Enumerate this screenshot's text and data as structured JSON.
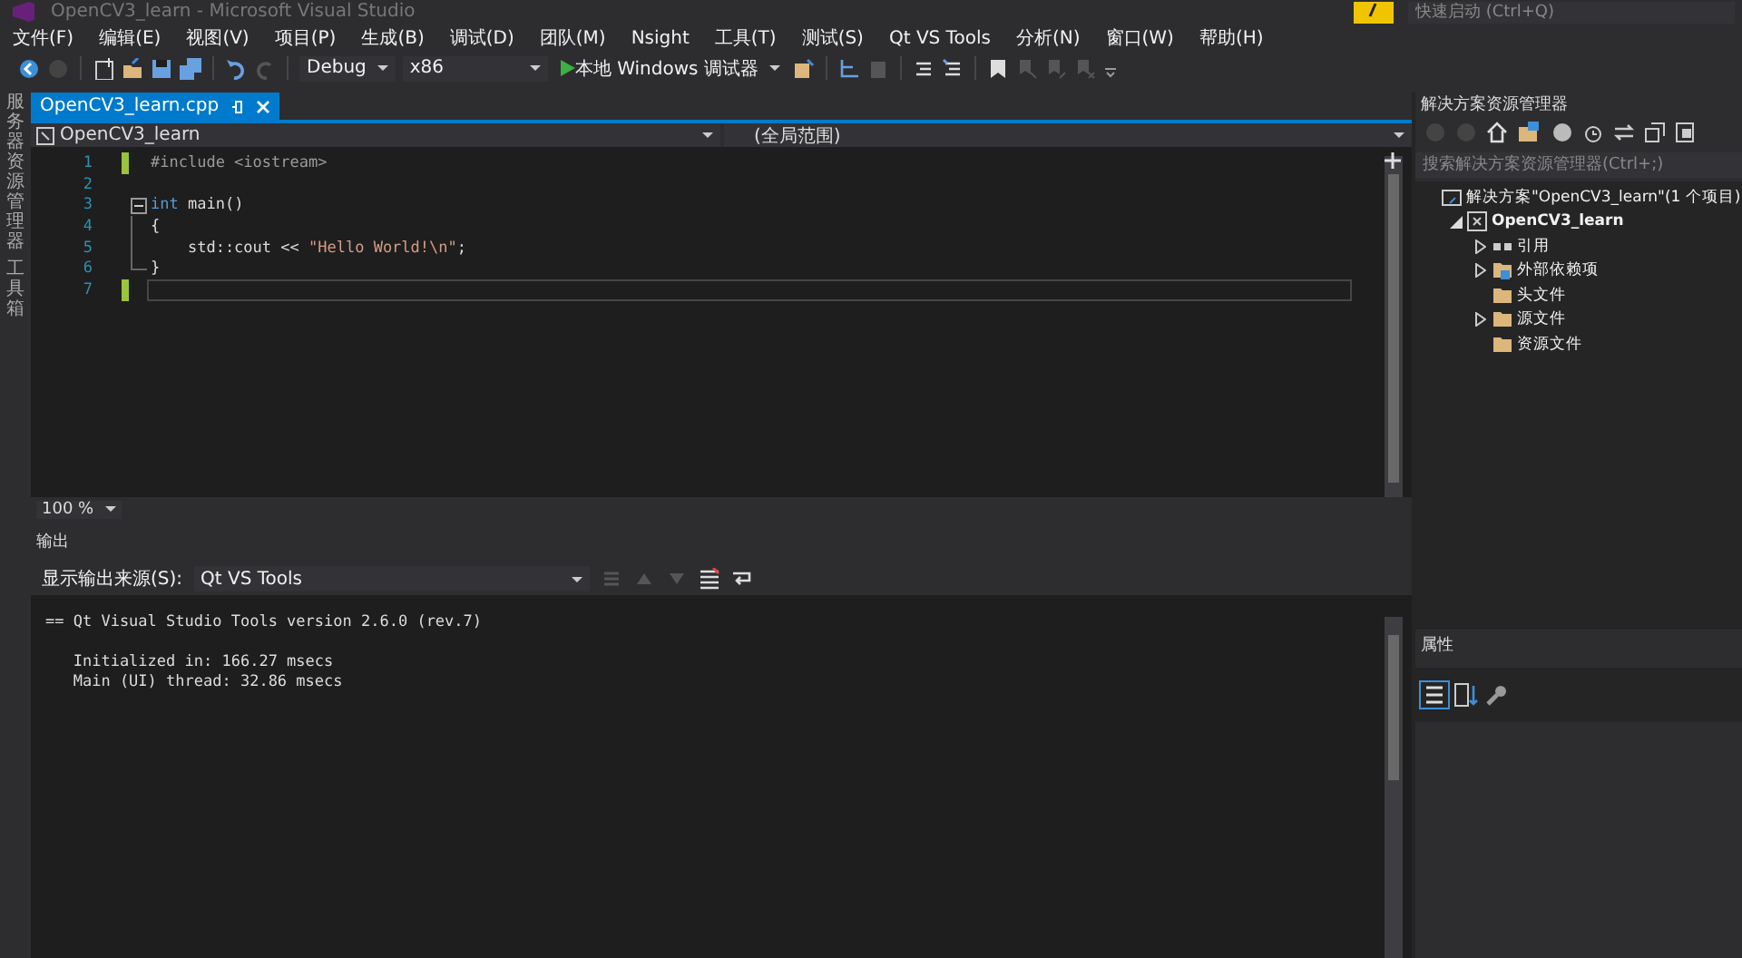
{
  "window": {
    "title": "OpenCV3_learn - Microsoft Visual Studio"
  },
  "quick_launch": {
    "placeholder": "快速启动 (Ctrl+Q)"
  },
  "menu": [
    "文件(F)",
    "编辑(E)",
    "视图(V)",
    "项目(P)",
    "生成(B)",
    "调试(D)",
    "团队(M)",
    "Nsight",
    "工具(T)",
    "测试(S)",
    "Qt VS Tools",
    "分析(N)",
    "窗口(W)",
    "帮助(H)"
  ],
  "toolbar": {
    "configuration": "Debug",
    "platform": "x86",
    "run": "本地 Windows 调试器"
  },
  "left_tabs": [
    "服务器资源管理器",
    "工具箱"
  ],
  "editor": {
    "tabs": [
      {
        "label": "OpenCV3_learn.cpp",
        "selected": true
      }
    ],
    "nav": {
      "project": "OpenCV3_learn",
      "scope": "(全局范围)"
    },
    "lines": [
      {
        "number": "1",
        "changed": true,
        "current": false,
        "kind": "plain",
        "tokens": [
          {
            "kind": "preproc",
            "text": "#include <iostream>"
          }
        ]
      },
      {
        "number": "2",
        "changed": false,
        "current": false,
        "kind": "plain"
      },
      {
        "number": "3",
        "changed": false,
        "current": false,
        "kind": "block_start",
        "tokens": [
          {
            "kind": "keyword",
            "text": "int"
          },
          {
            "kind": "plain",
            "text": " main()"
          }
        ]
      },
      {
        "number": "4",
        "changed": false,
        "current": false,
        "kind": "block_body",
        "tokens": [
          {
            "kind": "plain",
            "text": "{"
          }
        ]
      },
      {
        "number": "5",
        "changed": false,
        "current": false,
        "kind": "block_body",
        "tokens": [
          {
            "kind": "plain",
            "text": "    std::cout << "
          },
          {
            "kind": "string",
            "text": "\"Hello World!\\n\""
          },
          {
            "kind": "plain",
            "text": ";"
          }
        ]
      },
      {
        "number": "6",
        "changed": false,
        "current": false,
        "kind": "block_end",
        "tokens": [
          {
            "kind": "plain",
            "text": "}"
          }
        ]
      },
      {
        "number": "7",
        "changed": true,
        "current": true,
        "kind": "plain"
      }
    ],
    "zoom": "100 %"
  },
  "output": {
    "title": "输出",
    "source_label": "显示输出来源(S):",
    "source": "Qt VS Tools",
    "lines": [
      "== Qt Visual Studio Tools version 2.6.0 (rev.7)",
      "   Initialized in: 166.27 msecs",
      "   Main (UI) thread: 32.86 msecs"
    ]
  },
  "solution_explorer": {
    "title": "解决方案资源管理器",
    "search": {
      "placeholder": "搜索解决方案资源管理器(Ctrl+;)"
    },
    "items": [
      {
        "label": "解决方案\"OpenCV3_learn\"(1 个项目)",
        "kind": "solution",
        "bold": false,
        "children": [
          {
            "label": "OpenCV3_learn",
            "kind": "project",
            "expanded": true,
            "bold": true,
            "children": [
              {
                "label": "引用",
                "kind": "references",
                "expanded": false,
                "bold": false
              },
              {
                "label": "外部依赖项",
                "kind": "dependencies",
                "expanded": false,
                "bold": false
              },
              {
                "label": "头文件",
                "kind": "folder",
                "bold": false
              },
              {
                "label": "源文件",
                "kind": "folder",
                "expanded": false,
                "bold": false
              },
              {
                "label": "资源文件",
                "kind": "folder",
                "bold": false
              }
            ]
          }
        ]
      }
    ]
  },
  "properties": {
    "title": "属性"
  }
}
